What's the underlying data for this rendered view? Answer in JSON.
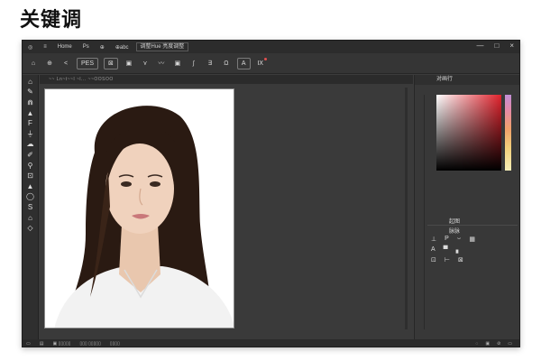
{
  "heading": "关键调",
  "menubar": {
    "items": [
      "◎",
      "≡",
      "Home",
      "Ps",
      "⊕",
      "⊕abc",
      "abc"
    ],
    "boxed_item": "调整Hue 亮度调整",
    "controls": [
      "—",
      "□",
      "×"
    ]
  },
  "options_bar": {
    "items": [
      "⌂",
      "⊕",
      "<",
      "PES",
      "⊠",
      "▣",
      "⋎",
      "〰",
      "▣",
      "∫",
      "∃",
      "Ω",
      "A",
      "Ⅸ"
    ]
  },
  "tools": [
    "⌂",
    "✎",
    "⋒",
    "▲",
    "F",
    "⏚",
    "☁",
    "✐",
    "⚲",
    "⊡",
    "▲",
    "◯",
    "S",
    "⌂",
    "◇"
  ],
  "document": {
    "tab_text": "~~ Ln~t~~l ~l...  ~~OOSOO",
    "photo_description_alt": "portrait"
  },
  "panels": {
    "header_label": "对画行",
    "label_a": "起图",
    "label_b": "脉脉",
    "row1": [
      "⊥",
      "P",
      "⌣",
      "▦"
    ],
    "row2": [
      "A",
      "▀",
      "▖"
    ],
    "row3": [
      "⊡",
      "⊢",
      "⊠"
    ]
  },
  "status": {
    "left": [
      "▭",
      "▤",
      "▣ ▯▯▯▯▯",
      "▯▯▯ ▯▯▯▯▯",
      "▯▯▯▯"
    ],
    "right": [
      "◌",
      "▣",
      "⊘",
      "▭"
    ]
  },
  "colors": {
    "app_bg": "#3c3c3c",
    "menubar_bg": "#2c2c2c",
    "accent_red": "#e0222c"
  }
}
